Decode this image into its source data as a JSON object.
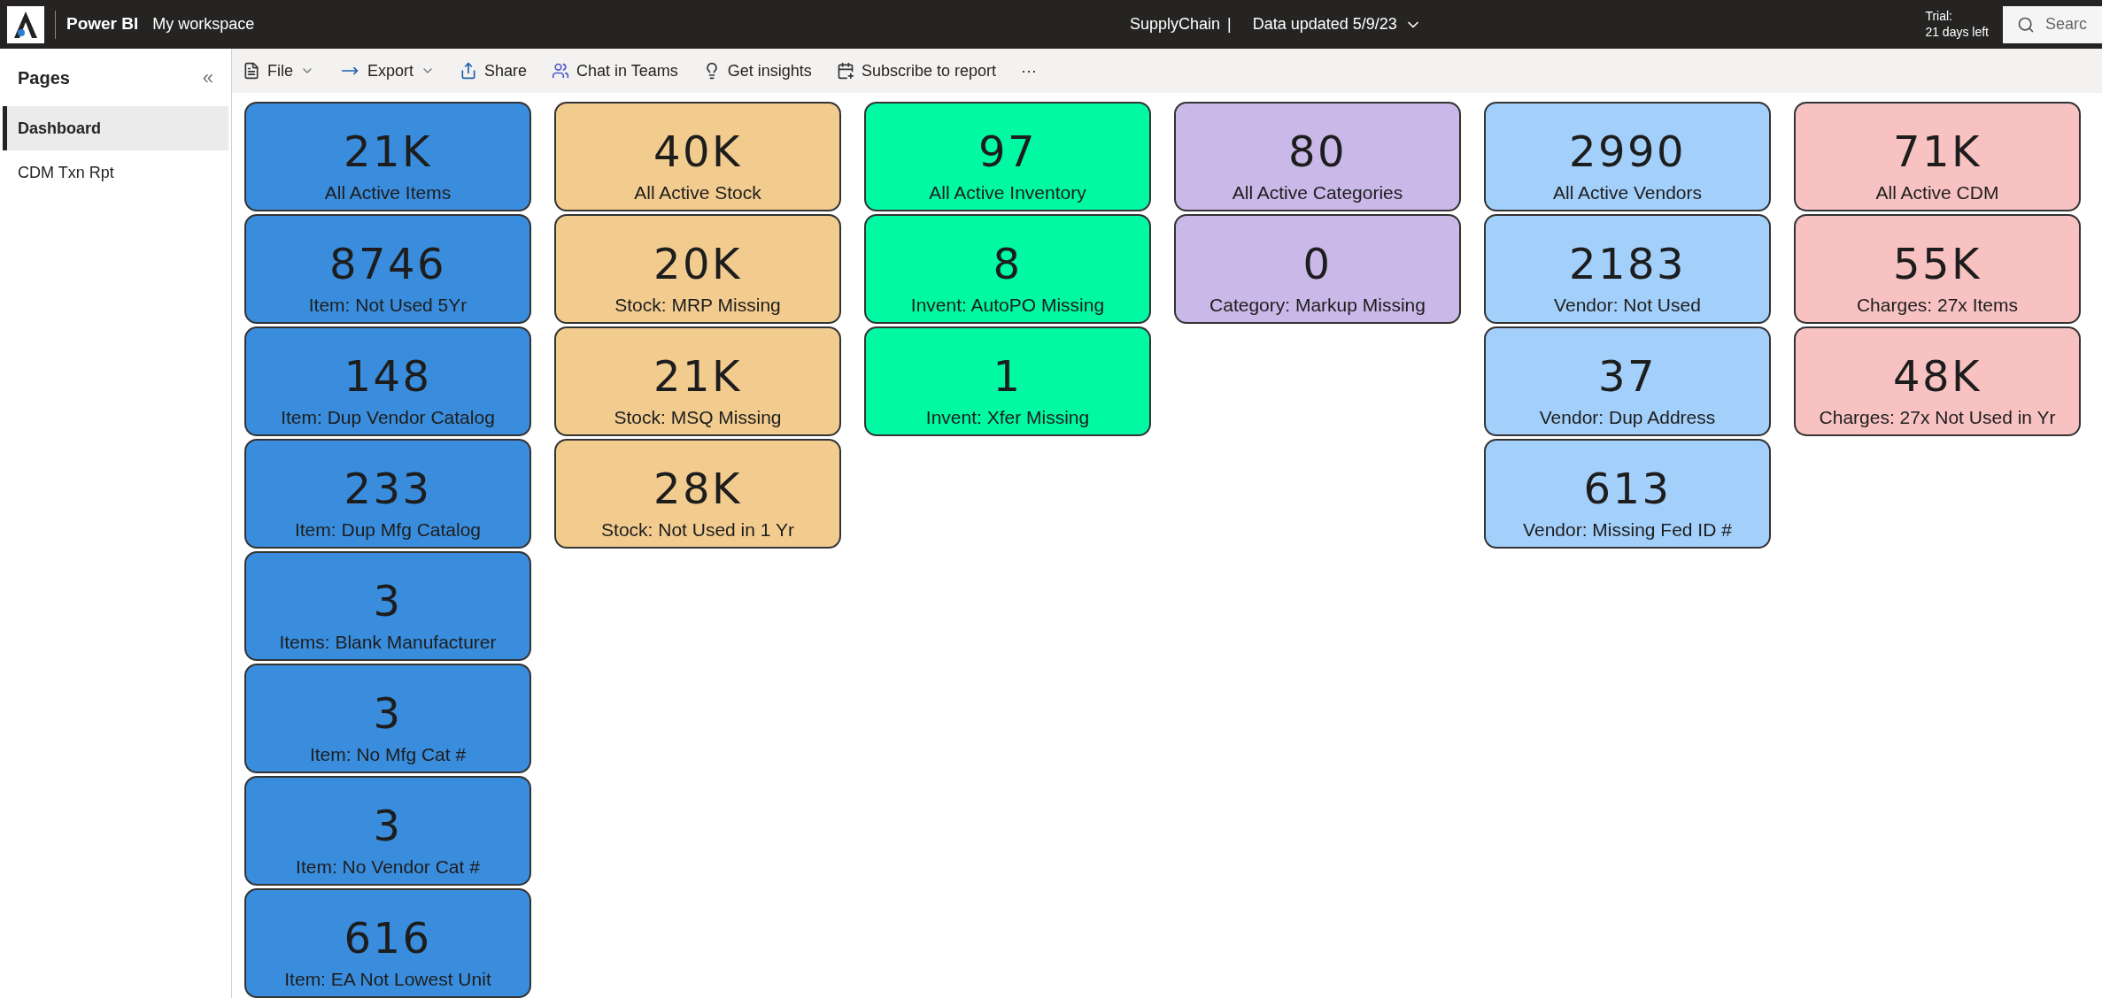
{
  "header": {
    "app_name": "Power BI",
    "workspace": "My workspace",
    "report_name": "SupplyChain",
    "separator": "|",
    "data_updated": "Data updated 5/9/23",
    "trial_label": "Trial:",
    "trial_days": "21 days left",
    "search": {
      "placeholder": "Searc"
    }
  },
  "toolbar": [
    {
      "kind": "file",
      "label": "File",
      "dropdown": true
    },
    {
      "kind": "export",
      "label": "Export",
      "dropdown": true
    },
    {
      "kind": "share",
      "label": "Share",
      "dropdown": false
    },
    {
      "kind": "teams",
      "label": "Chat in Teams",
      "dropdown": false
    },
    {
      "kind": "insights",
      "label": "Get insights",
      "dropdown": false
    },
    {
      "kind": "subscribe",
      "label": "Subscribe to report",
      "dropdown": false
    },
    {
      "kind": "more",
      "label": "···",
      "dropdown": false
    }
  ],
  "sidebar": {
    "title": "Pages",
    "collapse": "«",
    "items": [
      {
        "label": "Dashboard",
        "selected": true
      },
      {
        "label": "CDM Txn Rpt",
        "selected": false
      }
    ]
  },
  "columns": [
    {
      "color": "#3a8ddd",
      "cards": [
        {
          "value": "21K",
          "label": "All Active Items"
        },
        {
          "value": "8746",
          "label": "Item: Not Used 5Yr"
        },
        {
          "value": "148",
          "label": "Item: Dup Vendor Catalog"
        },
        {
          "value": "233",
          "label": "Item: Dup Mfg Catalog"
        },
        {
          "value": "3",
          "label": "Items: Blank Manufacturer"
        },
        {
          "value": "3",
          "label": "Item: No Mfg Cat #"
        },
        {
          "value": "3",
          "label": "Item: No Vendor Cat #"
        },
        {
          "value": "616",
          "label": "Item: EA Not Lowest Unit"
        }
      ]
    },
    {
      "color": "#f2cb8f",
      "cards": [
        {
          "value": "40K",
          "label": "All Active Stock"
        },
        {
          "value": "20K",
          "label": "Stock: MRP Missing"
        },
        {
          "value": "21K",
          "label": "Stock: MSQ Missing"
        },
        {
          "value": "28K",
          "label": "Stock: Not Used in 1 Yr"
        }
      ]
    },
    {
      "color": "#00f9a2",
      "cards": [
        {
          "value": "97",
          "label": "All Active Inventory"
        },
        {
          "value": "8",
          "label": "Invent: AutoPO Missing"
        },
        {
          "value": "1",
          "label": "Invent: Xfer Missing"
        }
      ]
    },
    {
      "color": "#c9b8e8",
      "cards": [
        {
          "value": "80",
          "label": "All Active Categories"
        },
        {
          "value": "0",
          "label": "Category: Markup Missing"
        }
      ]
    },
    {
      "color": "#a3cffb",
      "cards": [
        {
          "value": "2990",
          "label": "All Active Vendors"
        },
        {
          "value": "2183",
          "label": "Vendor: Not Used"
        },
        {
          "value": "37",
          "label": "Vendor: Dup Address"
        },
        {
          "value": "613",
          "label": "Vendor: Missing Fed ID #"
        }
      ]
    },
    {
      "color": "#f8c2c2",
      "cards": [
        {
          "value": "71K",
          "label": "All Active CDM"
        },
        {
          "value": "55K",
          "label": "Charges: 27x Items"
        },
        {
          "value": "48K",
          "label": "Charges: 27x Not Used in Yr"
        }
      ]
    }
  ]
}
